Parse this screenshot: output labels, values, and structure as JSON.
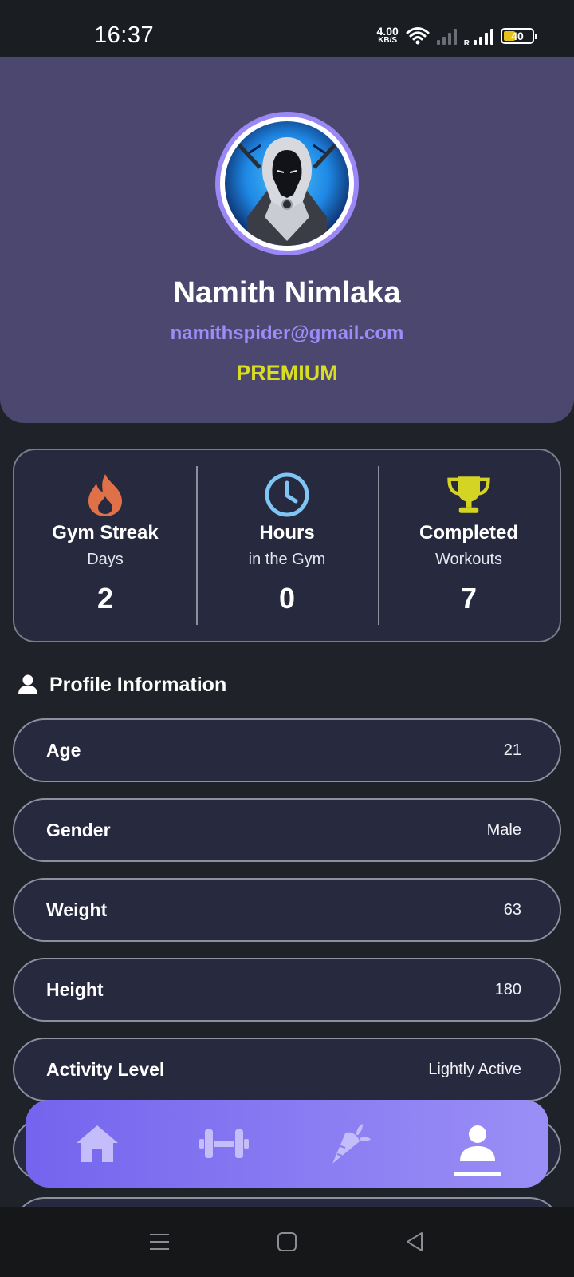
{
  "status_bar": {
    "time": "16:37",
    "net_speed_value": "4.00",
    "net_speed_unit": "KB/S",
    "signal_label": "R",
    "battery": "40"
  },
  "profile": {
    "name": "Namith Nimlaka",
    "email": "namithspider@gmail.com",
    "plan": "PREMIUM",
    "accent_color": "#9b87f5",
    "plan_color": "#d8dd22"
  },
  "stats": [
    {
      "icon": "fire-icon",
      "title": "Gym Streak",
      "subtitle": "Days",
      "value": "2",
      "color": "#e07048"
    },
    {
      "icon": "clock-icon",
      "title": "Hours",
      "subtitle": "in the Gym",
      "value": "0",
      "color": "#7fc6f5"
    },
    {
      "icon": "trophy-icon",
      "title": "Completed",
      "subtitle": "Workouts",
      "value": "7",
      "color": "#d4d424"
    }
  ],
  "profile_info": {
    "title": "Profile Information",
    "rows": [
      {
        "label": "Age",
        "value": "21"
      },
      {
        "label": "Gender",
        "value": "Male"
      },
      {
        "label": "Weight",
        "value": "63"
      },
      {
        "label": "Height",
        "value": "180"
      },
      {
        "label": "Activity Level",
        "value": "Lightly Active"
      }
    ]
  },
  "bottom_nav": {
    "items": [
      {
        "icon": "home-icon",
        "active": false
      },
      {
        "icon": "dumbbell-icon",
        "active": false
      },
      {
        "icon": "carrot-icon",
        "active": false
      },
      {
        "icon": "profile-icon",
        "active": true
      }
    ]
  }
}
